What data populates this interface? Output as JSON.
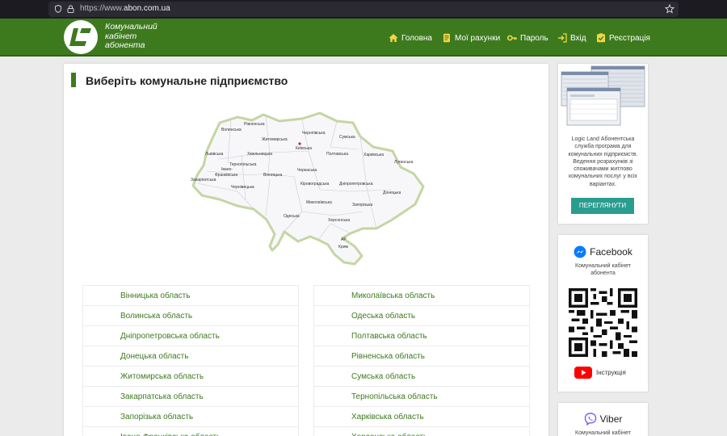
{
  "browser": {
    "url_prefix": "https://www.",
    "url_domain": "abon.com.ua"
  },
  "header": {
    "logo_line1": "Комунальний",
    "logo_line2": "кабінет",
    "logo_line3": "абонента",
    "nav": [
      {
        "label": "Головна",
        "icon": "home-icon"
      },
      {
        "label": "Мої рахунки",
        "icon": "document-icon"
      },
      {
        "label": "Пароль",
        "icon": "key-icon"
      },
      {
        "label": "Вхід",
        "icon": "login-icon"
      },
      {
        "label": "Реєстрація",
        "icon": "checklist-icon"
      }
    ]
  },
  "main": {
    "title": "Виберіть комунальне підприємство",
    "map_labels": [
      "Рівненська",
      "Волинська",
      "Чернігівська",
      "Сумська",
      "Житомирська",
      "Київська",
      "Львівська",
      "Хмельницька",
      "Полтавська",
      "Харківська",
      "Тернопільська",
      "Луганська",
      "Івано-",
      "Франківська",
      "Вінницька",
      "Черкаська",
      "Закарпатська",
      "Чернівецька",
      "Кіровоградська",
      "Дніпропетровська",
      "Донецька",
      "Миколаївська",
      "Запорізька",
      "Одеська",
      "Херсонська",
      "АР",
      "Крим"
    ],
    "regions_left": [
      "Вінницька область",
      "Волинська область",
      "Дніпропетровська область",
      "Донецька область",
      "Житомирська область",
      "Закарпатська область",
      "Запорізька область",
      "Івано-Франківська область"
    ],
    "regions_right": [
      "Миколаївська область",
      "Одеська область",
      "Полтавська область",
      "Рівненська область",
      "Сумська область",
      "Тернопільська область",
      "Харківська область",
      "Херсонська область"
    ]
  },
  "sidebar": {
    "promo_lines": [
      "Logic Land Абонентська",
      "служба   програма для",
      "комунальних підприємств.",
      "Ведення розрахунків зі",
      "споживачами житлово",
      "комунальних послуг у всіх",
      "варіантах."
    ],
    "view_button": "ПЕРЕГЛЯНУТИ",
    "facebook_title": "Facebook",
    "facebook_sub1": "Комунальний кабінет",
    "facebook_sub2": "абонента",
    "youtube_label": "Інструкція",
    "viber_title": "Viber",
    "viber_sub1": "Комунальний кабінет"
  },
  "colors": {
    "brand_green": "#3d7a1e",
    "button_teal": "#2a9d8f"
  }
}
